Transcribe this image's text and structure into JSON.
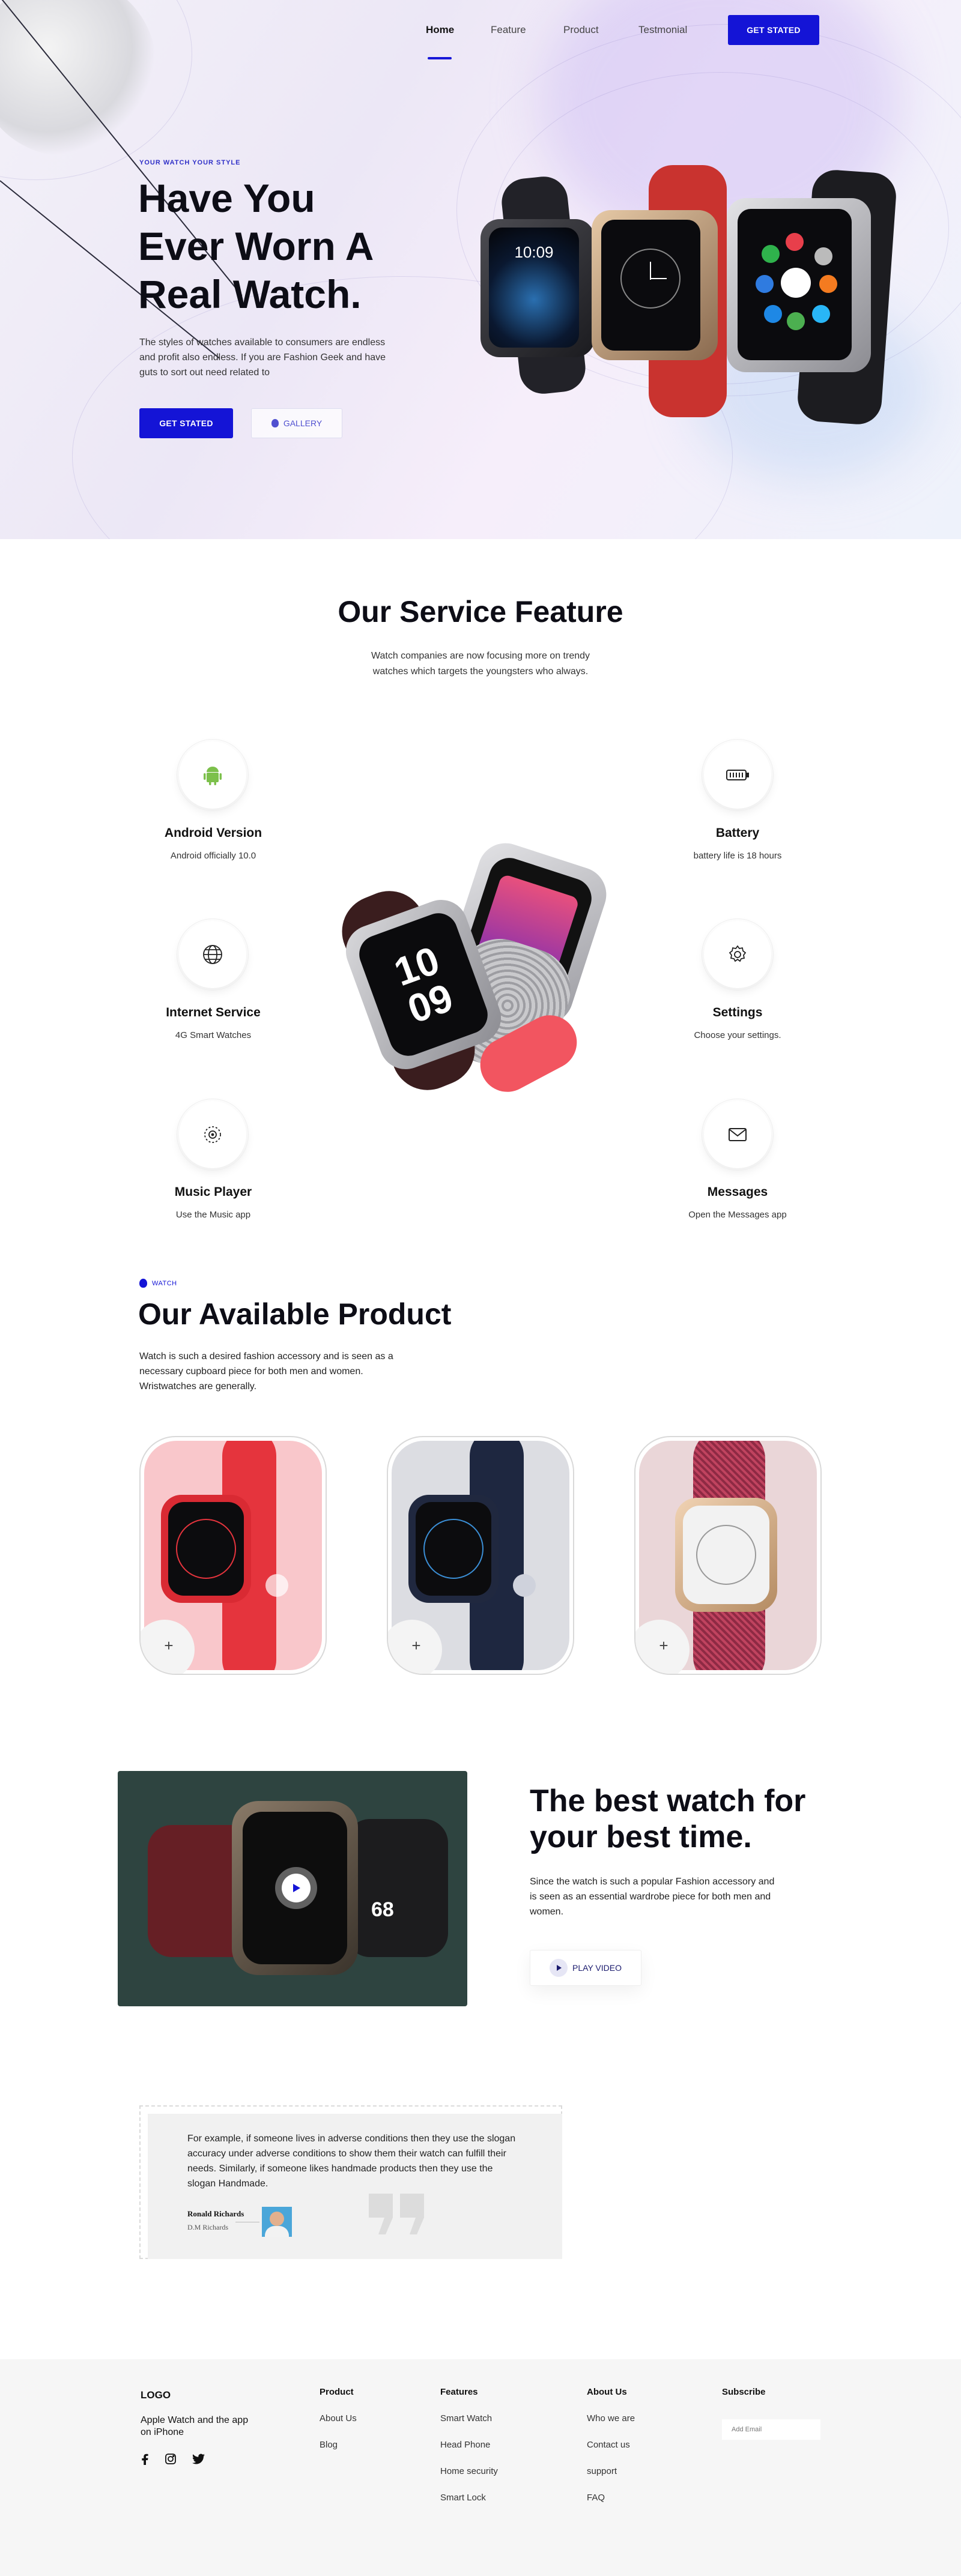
{
  "nav": {
    "items": [
      "Home",
      "Feature",
      "Product",
      "Testmonial"
    ],
    "cta": "GET STATED"
  },
  "hero": {
    "tagline": "YOUR WATCH YOUR STYLE",
    "title_lines": [
      "Have You",
      "Ever Worn A",
      "Real Watch."
    ],
    "description": "The styles of watches available to consumers are endless and profit also endless. If you are Fashion Geek and have guts to sort out need related to",
    "primary_button": "GET STATED",
    "secondary_button": "GALLERY",
    "watch_time": "10:09"
  },
  "service": {
    "title": "Our Service Feature",
    "subtitle_lines": [
      "Watch companies are now focusing more on trendy",
      "watches which targets the youngsters who always."
    ],
    "features": [
      {
        "title": "Android Version",
        "desc": "Android officially 10.0",
        "icon": "android-icon"
      },
      {
        "title": "Internet Service",
        "desc": "4G Smart Watches",
        "icon": "globe-icon"
      },
      {
        "title": "Music Player",
        "desc": "Use the Music app",
        "icon": "music-icon"
      },
      {
        "title": "Battery",
        "desc": "battery life is 18 hours",
        "icon": "battery-icon"
      },
      {
        "title": "Settings",
        "desc": "Choose your settings.",
        "icon": "gear-icon"
      },
      {
        "title": "Messages",
        "desc": "Open the Messages app",
        "icon": "envelope-icon"
      }
    ],
    "watch_display": [
      "10",
      "09"
    ]
  },
  "products": {
    "badge": "WATCH",
    "title": "Our Available Product",
    "description_lines": [
      "Watch is such a desired fashion accessory and is seen as a",
      "necessary cupboard piece for both men and women.",
      "Wristwatches are generally."
    ],
    "cards": [
      {
        "name": "red-watch",
        "bg": "#f9c7cb",
        "band": "#e5343d"
      },
      {
        "name": "navy-watch",
        "bg": "#dcdde2",
        "band": "#1e2740"
      },
      {
        "name": "gold-pink-watch",
        "bg": "#ead6d8",
        "band": "#c0435f"
      }
    ],
    "plus": "+"
  },
  "video": {
    "title_lines": [
      "The best watch for",
      "your best time."
    ],
    "description": "Since the watch is such a popular Fashion accessory and is seen as an essential wardrobe piece for both men and women.",
    "button": "PLAY VIDEO",
    "readout": "68"
  },
  "testimonial": {
    "quote": "For example, if someone lives in adverse conditions then they use the slogan accuracy under adverse conditions to show them their watch can fulfill their needs. Similarly, if someone likes handmade products then they use the slogan Handmade.",
    "author": "Ronald Richards",
    "role": "D.M Richards"
  },
  "footer": {
    "logo": "LOGO",
    "tagline": "Apple Watch and the app on iPhone",
    "columns": [
      {
        "heading": "Product",
        "links": [
          "About Us",
          "Blog"
        ]
      },
      {
        "heading": "Features",
        "links": [
          "Smart Watch",
          "Head Phone",
          "Home security",
          "Smart Lock"
        ]
      },
      {
        "heading": "About Us",
        "links": [
          "Who we are",
          "Contact us",
          "support",
          "FAQ"
        ]
      }
    ],
    "subscribe_heading": "Subscribe",
    "email_placeholder": "Add Email"
  },
  "colors": {
    "accent": "#1414d6",
    "dark": "#0d0d16",
    "footer_bg": "#f6f6f6"
  }
}
